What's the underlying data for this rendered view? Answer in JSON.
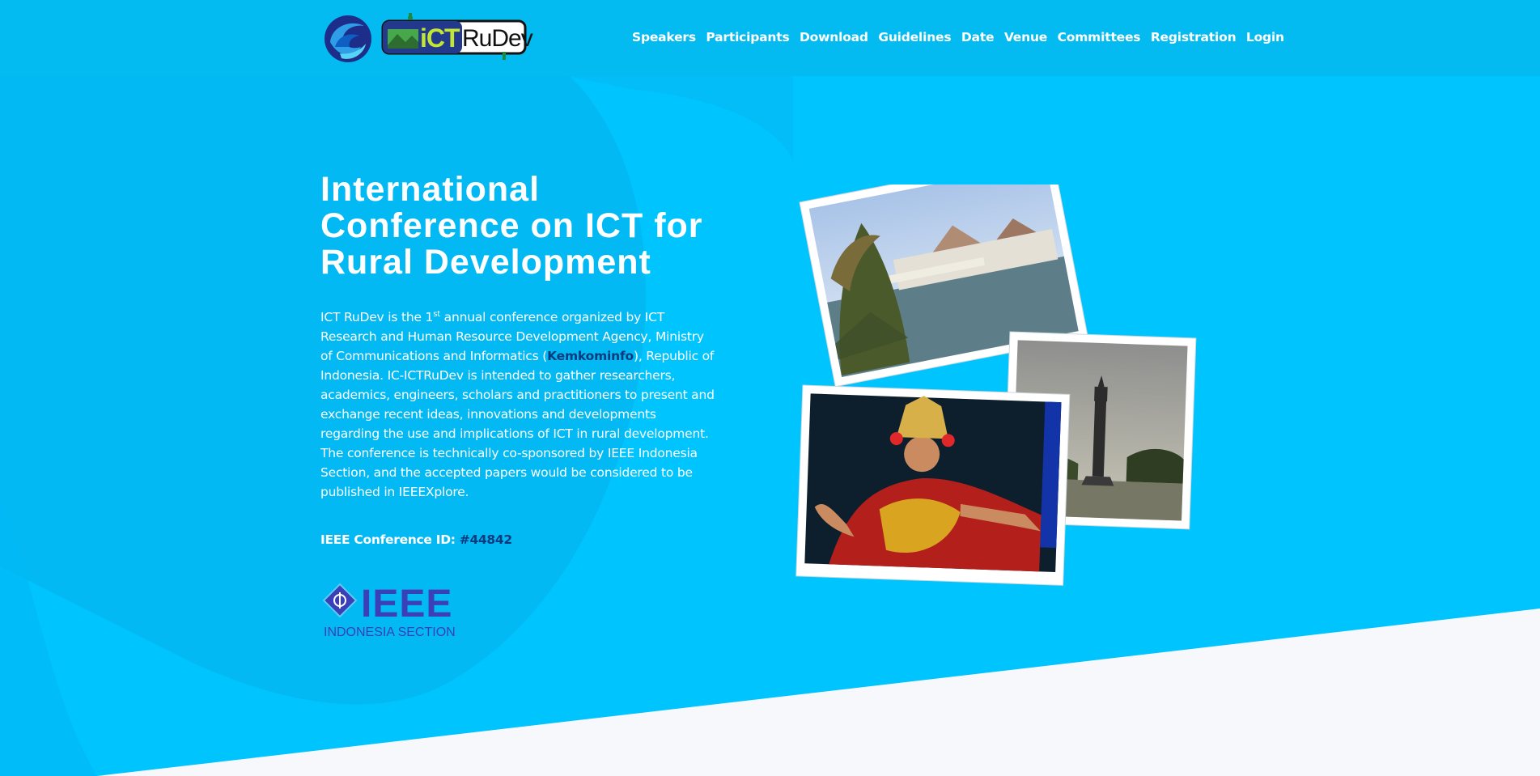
{
  "navbar": {
    "logo_ict": "iCT",
    "logo_rudev": "RuDev",
    "items": [
      {
        "label": "Speakers"
      },
      {
        "label": "Participants"
      },
      {
        "label": "Download"
      },
      {
        "label": "Guidelines"
      },
      {
        "label": "Date"
      },
      {
        "label": "Venue"
      },
      {
        "label": "Committees"
      },
      {
        "label": "Registration"
      },
      {
        "label": "Login"
      }
    ]
  },
  "hero": {
    "title": "International Conference on ICT for Rural Development",
    "intro": {
      "part1": "ICT RuDev is the 1",
      "sup": "st",
      "part2": " annual conference organized by ICT Research and Human Resource Development Agency, Ministry of Communications and Informatics (",
      "link": "Kemkominfo",
      "part3": "), Republic of Indonesia. IC-ICTRuDev is intended to gather researchers, academics, engineers, scholars and practitioners to present and exchange recent ideas, innovations and developments regarding the use and implications of ICT in rural development. The conference is technically co-sponsored by IEEE Indonesia Section, and the accepted papers would be considered to be published in IEEEXplore."
    },
    "conference_id_label": "IEEE Conference ID: ",
    "conference_id_value": "#44842",
    "ieee_logo_text": "IEEE",
    "ieee_logo_subtext": "INDONESIA SECTION"
  },
  "colors": {
    "primary": "#04bbf1",
    "hero_bg": "#00c3ff",
    "footer_bg": "#f6f8fb",
    "link_dark": "#083b7d"
  }
}
